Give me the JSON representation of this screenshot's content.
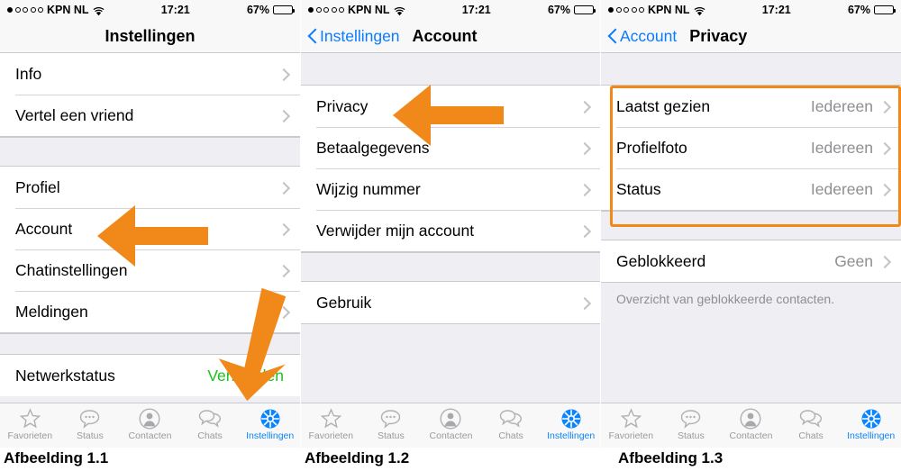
{
  "status_bar": {
    "carrier": "KPN NL",
    "signal_dots_total": 5,
    "signal_dots_filled": 1,
    "wifi_icon": "wifi-icon",
    "time": "17:21",
    "battery_percent": "67%",
    "battery_level": 0.67
  },
  "colors": {
    "accent_blue": "#0a84ff",
    "annotation_orange": "#f0891a",
    "connected_green": "#19c319",
    "value_gray": "#8e8e93"
  },
  "panel1": {
    "nav": {
      "title": "Instellingen"
    },
    "sections": [
      {
        "rows": [
          {
            "label": "Info",
            "value": "",
            "chevron": true
          },
          {
            "label": "Vertel een vriend",
            "value": "",
            "chevron": true
          }
        ]
      },
      {
        "rows": [
          {
            "label": "Profiel",
            "value": "",
            "chevron": true
          },
          {
            "label": "Account",
            "value": "",
            "chevron": true
          },
          {
            "label": "Chatinstellingen",
            "value": "",
            "chevron": true
          },
          {
            "label": "Meldingen",
            "value": "",
            "chevron": true
          }
        ]
      },
      {
        "rows": [
          {
            "label": "Netwerkstatus",
            "value": "Verbonden",
            "value_style": "green",
            "chevron": false
          }
        ]
      }
    ],
    "caption": "Afbeelding 1.1"
  },
  "panel2": {
    "nav": {
      "back_label": "Instellingen",
      "title": "Account"
    },
    "sections": [
      {
        "rows": [
          {
            "label": "Privacy",
            "value": "",
            "chevron": true
          },
          {
            "label": "Betaalgegevens",
            "value": "",
            "chevron": true
          },
          {
            "label": "Wijzig nummer",
            "value": "",
            "chevron": true
          },
          {
            "label": "Verwijder mijn account",
            "value": "",
            "chevron": true
          }
        ]
      },
      {
        "rows": [
          {
            "label": "Gebruik",
            "value": "",
            "chevron": true
          }
        ]
      }
    ],
    "caption": "Afbeelding 1.2"
  },
  "panel3": {
    "nav": {
      "back_label": "Account",
      "title": "Privacy"
    },
    "sections": [
      {
        "highlighted": true,
        "rows": [
          {
            "label": "Laatst gezien",
            "value": "Iedereen",
            "chevron": true
          },
          {
            "label": "Profielfoto",
            "value": "Iedereen",
            "chevron": true
          },
          {
            "label": "Status",
            "value": "Iedereen",
            "chevron": true
          }
        ]
      },
      {
        "rows": [
          {
            "label": "Geblokkeerd",
            "value": "Geen",
            "chevron": true
          }
        ]
      }
    ],
    "footnote": "Overzicht van geblokkeerde contacten.",
    "caption": "Afbeelding 1.3"
  },
  "tabbar": {
    "tabs": [
      {
        "label": "Favorieten",
        "icon": "star-icon",
        "active": false
      },
      {
        "label": "Status",
        "icon": "speech-bubble-dots-icon",
        "active": false
      },
      {
        "label": "Contacten",
        "icon": "person-circle-icon",
        "active": false
      },
      {
        "label": "Chats",
        "icon": "chat-bubbles-icon",
        "active": false
      },
      {
        "label": "Instellingen",
        "icon": "gear-icon",
        "active": true
      }
    ]
  },
  "annotations": {
    "arrow_account": "left-arrow-pointing-to-account",
    "arrow_instellingen": "down-arrow-pointing-to-instellingen-tab",
    "arrow_privacy": "left-arrow-pointing-to-privacy",
    "highlight_box": "orange-highlight-around-privacy-options"
  }
}
